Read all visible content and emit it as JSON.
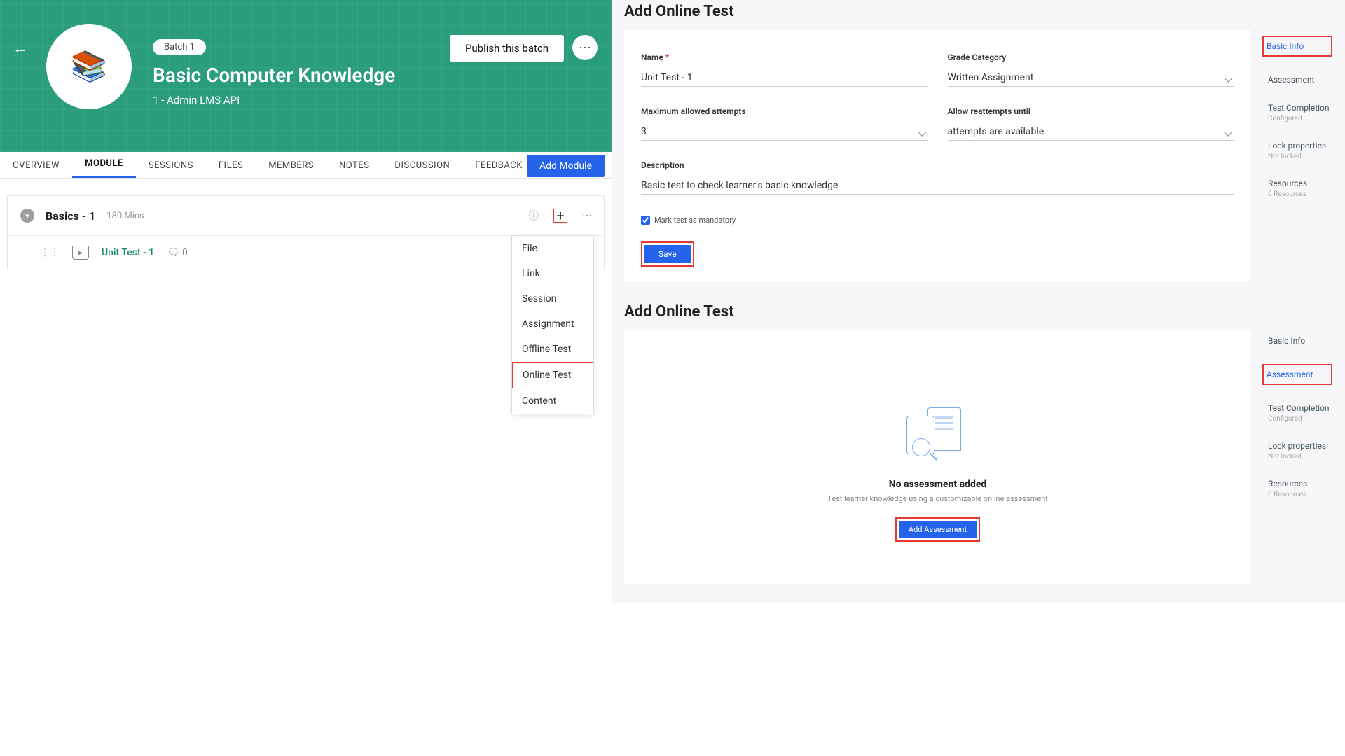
{
  "course": {
    "batch_pill": "Batch 1",
    "title": "Basic Computer Knowledge",
    "subtitle": "1 - Admin LMS API",
    "publish_btn": "Publish this batch"
  },
  "tabs": {
    "items": [
      "OVERVIEW",
      "MODULE",
      "SESSIONS",
      "FILES",
      "MEMBERS",
      "NOTES",
      "DISCUSSION",
      "FEEDBACK"
    ],
    "active_index": 1,
    "add_module_btn": "Add Module"
  },
  "module": {
    "name": "Basics - 1",
    "duration": "180 Mins",
    "item_title": "Unit Test - 1",
    "comment_count": "0"
  },
  "dropdown": {
    "items": [
      "File",
      "Link",
      "Session",
      "Assignment",
      "Offline Test",
      "Online Test",
      "Content"
    ],
    "highlight_index": 5
  },
  "panel1": {
    "title": "Add Online Test",
    "form": {
      "name_label": "Name",
      "name_value": "Unit Test - 1",
      "grade_label": "Grade Category",
      "grade_value": "Written Assignment",
      "attempts_label": "Maximum allowed attempts",
      "attempts_value": "3",
      "reattempt_label": "Allow reattempts until",
      "reattempt_value": "attempts are available",
      "desc_label": "Description",
      "desc_value": "Basic test to check learner's basic knowledge",
      "mandatory_label": "Mark test as mandatory",
      "save_btn": "Save"
    },
    "side_nav": {
      "basic": "Basic Info",
      "assessment": "Assessment",
      "completion": "Test Completion",
      "completion_sub": "Configured",
      "lock": "Lock properties",
      "lock_sub": "Not locked",
      "resources": "Resources",
      "resources_sub": "0 Resources"
    }
  },
  "panel2": {
    "title": "Add Online Test",
    "empty": {
      "title": "No assessment added",
      "sub": "Test learner knowledge using a customizable online assessment",
      "btn": "Add Assessment"
    },
    "side_nav": {
      "basic": "Basic Info",
      "assessment": "Assessment",
      "completion": "Test Completion",
      "completion_sub": "Configured",
      "lock": "Lock properties",
      "lock_sub": "Not locked",
      "resources": "Resources",
      "resources_sub": "0 Resources"
    }
  }
}
